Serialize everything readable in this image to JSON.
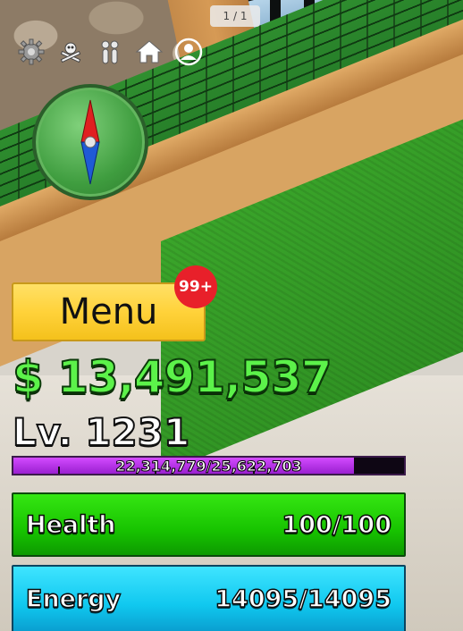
{
  "hud": {
    "page_counter": "1 / 1",
    "top_icons": [
      "gear-icon",
      "crew-flag-icon",
      "fruits-icon",
      "home-icon",
      "profile-icon"
    ],
    "menu_label": "Menu",
    "notification_badge": "99+",
    "money": "$ 13,491,537",
    "level": "Lv. 1231",
    "xp": {
      "text": "22,314,779/25,622,703",
      "current": 22314779,
      "max": 25622703
    },
    "health": {
      "label": "Health",
      "value": "100/100",
      "fraction": 1.0
    },
    "energy": {
      "label": "Energy",
      "value": "14095/14095",
      "fraction": 1.0
    }
  },
  "colors": {
    "money": "#5cf24a",
    "menu_button": "#ffd23a",
    "badge": "#e8202a",
    "xp_fill": "#c43cf5",
    "health": "#17c300",
    "energy": "#10c8ef"
  }
}
